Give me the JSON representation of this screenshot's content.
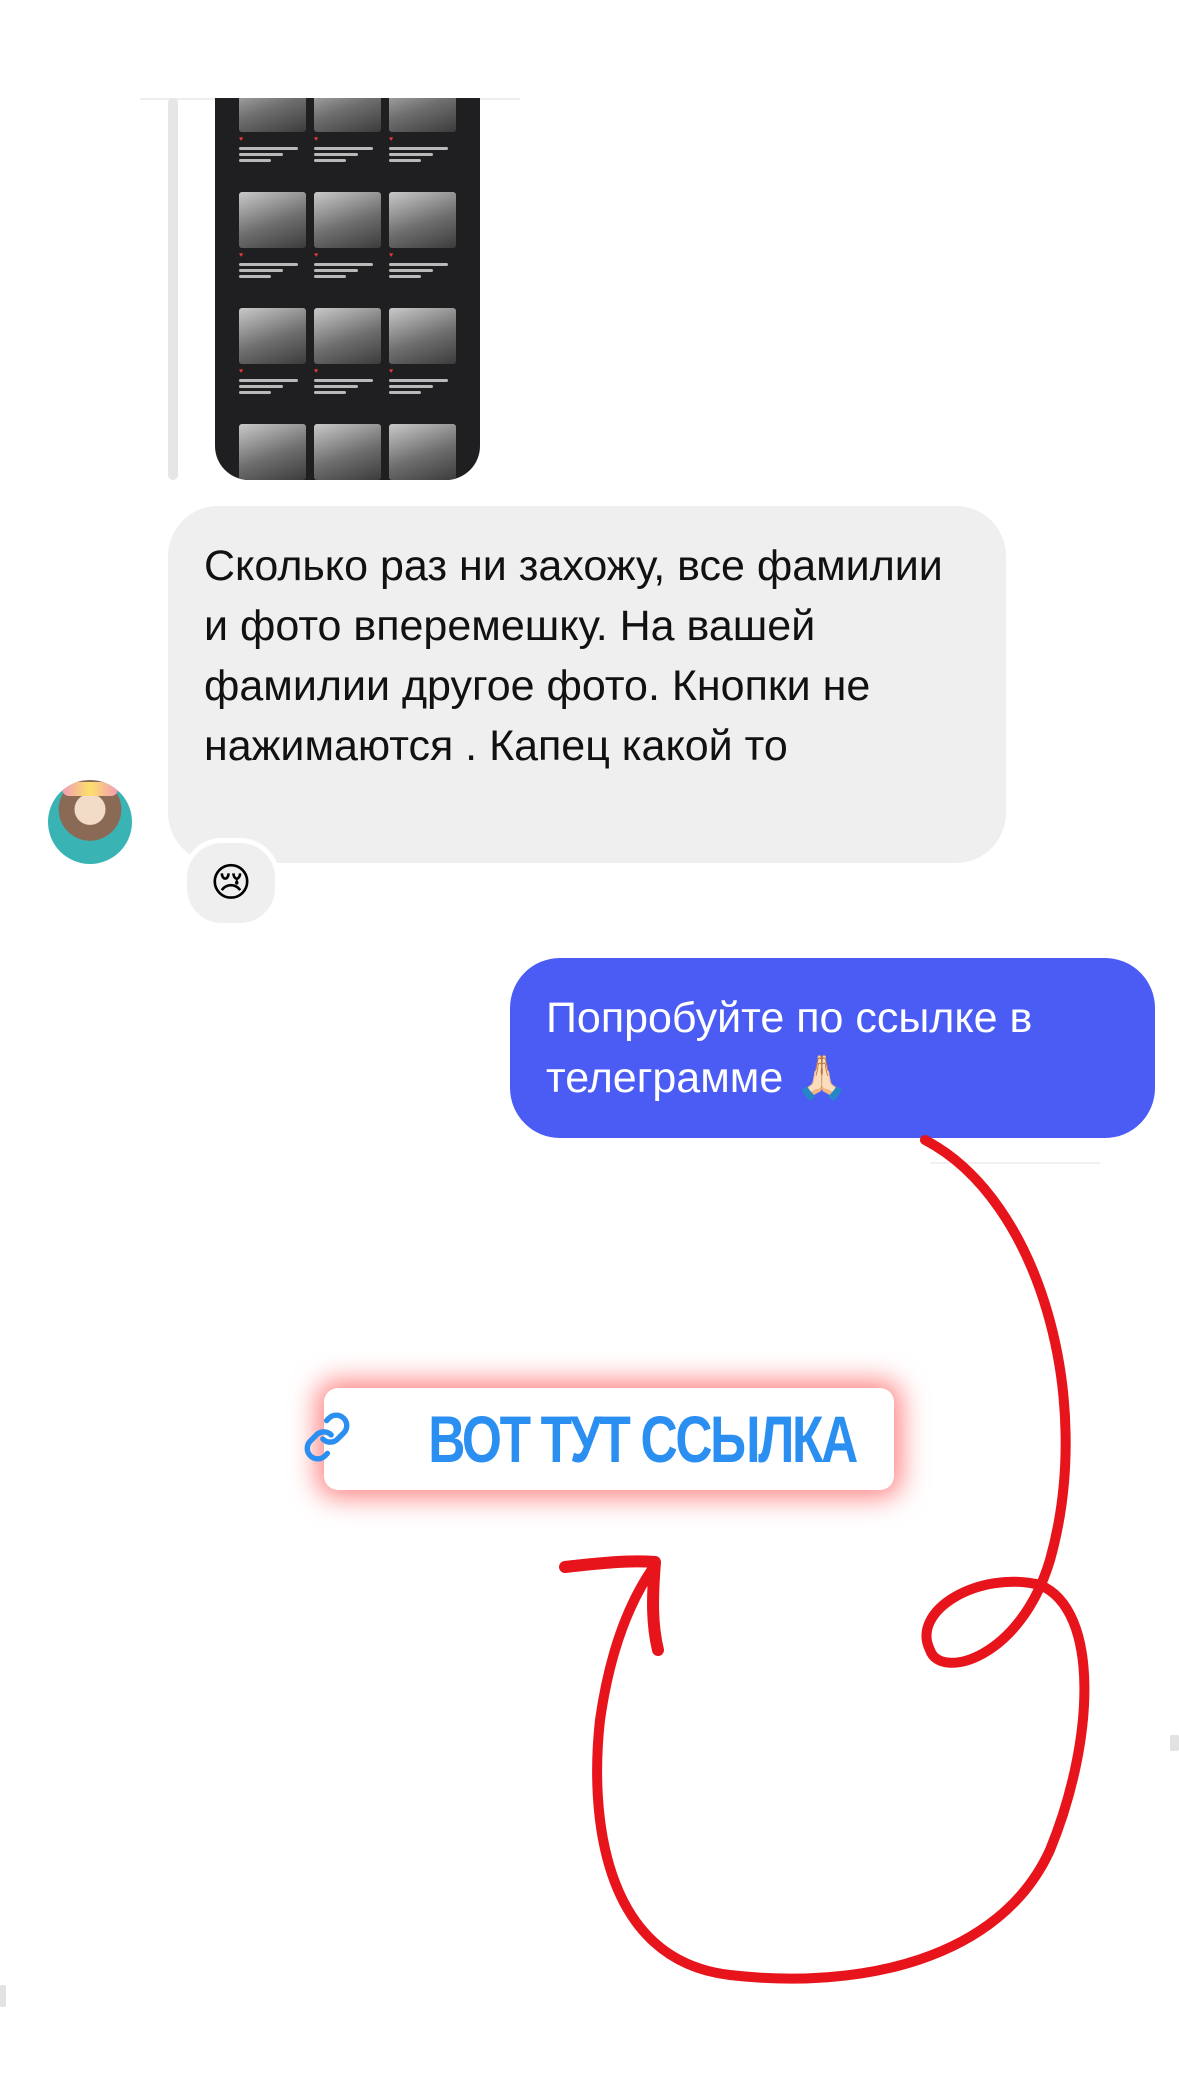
{
  "thread": {
    "shared_post": {
      "icon": "image-grid"
    },
    "incoming_message": {
      "text": "Сколько раз ни захожу, все фамилии и фото вперемешку. На вашей фамилии другое фото. Кнопки не нажимаются . Капец какой то",
      "reaction": "😢"
    },
    "outgoing_message": {
      "text": "Попробуйте по ссылке в телеграмме 🙏🏻"
    }
  },
  "link_sticker": {
    "label": "ВОТ ТУТ ССЫЛКА",
    "icon": "link-icon",
    "text_color": "#2a8ff0",
    "glow_color": "#ff2828"
  },
  "annotation": {
    "arrow_color": "#e8141c"
  },
  "colors": {
    "outgoing_bubble": "#4b5cf5",
    "incoming_bubble": "#efefef"
  }
}
